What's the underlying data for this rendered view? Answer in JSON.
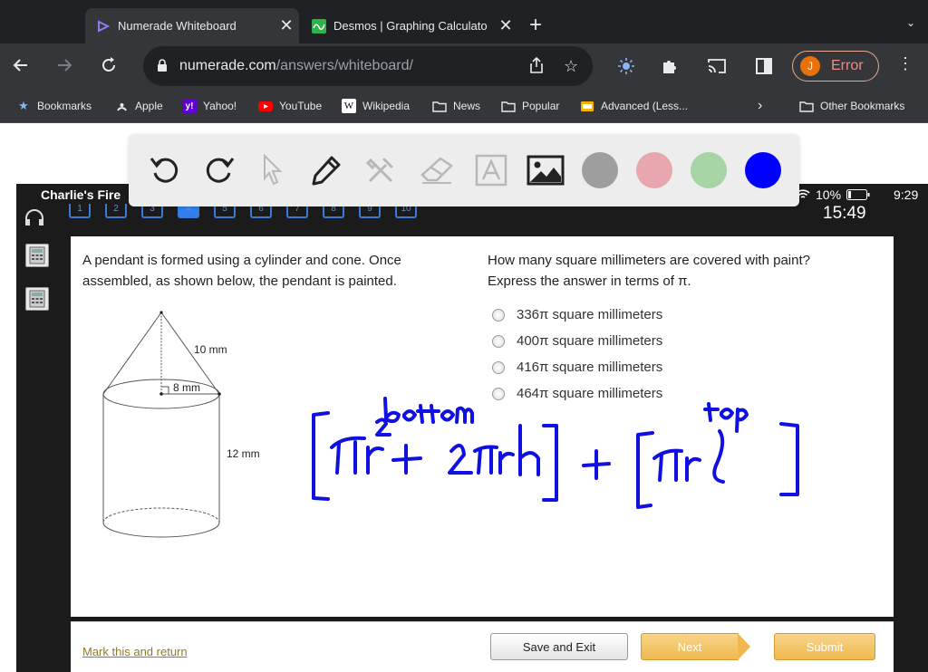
{
  "browser": {
    "tabs": [
      {
        "title": "Numerade Whiteboard",
        "active": true
      },
      {
        "title": "Desmos | Graphing Calculato",
        "active": false
      }
    ],
    "url_host": "numerade.com",
    "url_path": "/answers/whiteboard/",
    "profile_initial": "J",
    "profile_status": "Error",
    "bookmarks": [
      "Bookmarks",
      "Apple",
      "Yahoo!",
      "YouTube",
      "Wikipedia",
      "News",
      "Popular",
      "Advanced (Less...",
      "Other Bookmarks"
    ]
  },
  "whiteboard": {
    "colors": [
      "#9e9e9e",
      "#e8a7ae",
      "#a8d5a5",
      "#0000ff"
    ],
    "ink_color": "#1010e0",
    "annotations": {
      "bottom": "bottom",
      "top": "top",
      "formula": "[πr² + 2πrh] + [πrl]"
    }
  },
  "device": {
    "carrier": "Charlie's Fire",
    "battery": "10%",
    "clock": "9:29",
    "timer": "15:49",
    "question_numbers": [
      "1",
      "2",
      "3",
      "4",
      "5",
      "6",
      "7",
      "8",
      "9",
      "10"
    ],
    "current_question": "4"
  },
  "question": {
    "prompt": "A pendant is formed using a cylinder and cone. Once assembled, as shown below, the pendant is painted.",
    "ask_line1": "How many square millimeters are covered with paint?",
    "ask_line2": "Express the answer in terms of π.",
    "figure": {
      "slant": "10 mm",
      "radius": "8 mm",
      "height": "12 mm"
    },
    "choices": [
      "336π square millimeters",
      "400π square millimeters",
      "416π square millimeters",
      "464π square millimeters"
    ]
  },
  "footer": {
    "mark": "Mark this and return",
    "save": "Save and Exit",
    "next": "Next",
    "submit": "Submit"
  }
}
